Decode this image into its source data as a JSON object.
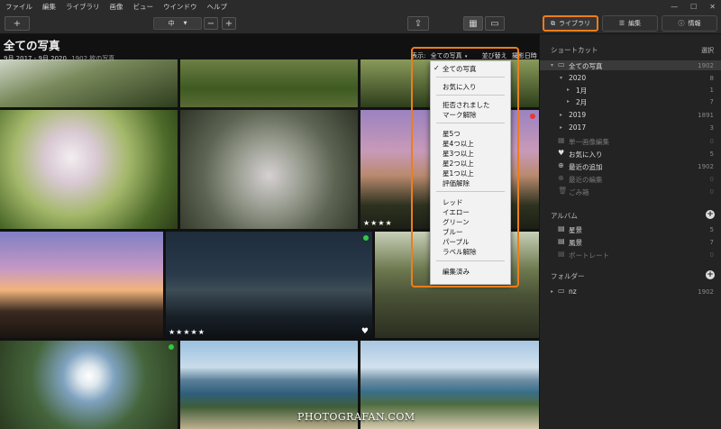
{
  "menubar": {
    "items": [
      "ファイル",
      "編集",
      "ライブラリ",
      "画像",
      "ビュー",
      "ウインドウ",
      "ヘルプ"
    ]
  },
  "window_controls": {
    "minimize": "—",
    "maximize": "☐",
    "close": "✕"
  },
  "toolbar": {
    "add": "+",
    "thumb_size": "中",
    "minus": "−",
    "plus": "+",
    "share": "⇪",
    "grid": "▦",
    "single": "▭",
    "library": "ライブラリ",
    "edit": "編集",
    "info": "情報"
  },
  "gallery": {
    "title": "全ての写真",
    "date_range": "9月 2017 - 9月 2020",
    "count": "1902 枚の写真",
    "view_label": "表示:",
    "view_value": "全ての写真",
    "sort_label": "並び替え",
    "sort_value": "撮影日時"
  },
  "photos": [
    {
      "stars": "",
      "heart": "",
      "dot": ""
    },
    {
      "stars": "",
      "heart": "",
      "dot": ""
    },
    {
      "stars": "",
      "heart": "",
      "dot": ""
    },
    {
      "stars": "",
      "heart": "",
      "dot": ""
    },
    {
      "stars": "",
      "heart": "",
      "dot": ""
    },
    {
      "stars": "★★★★",
      "heart": "",
      "dot": "red"
    },
    {
      "stars": "",
      "heart": "",
      "dot": ""
    },
    {
      "stars": "★★★★★",
      "heart": "♥",
      "dot": "green"
    },
    {
      "stars": "",
      "heart": "",
      "dot": ""
    },
    {
      "stars": "",
      "heart": "",
      "dot": "green"
    },
    {
      "stars": "",
      "heart": "",
      "dot": ""
    },
    {
      "stars": "",
      "heart": "",
      "dot": ""
    }
  ],
  "filter_menu": {
    "checked": "✓",
    "all": "全ての写真",
    "favorites": "お気に入り",
    "rejected": "拒否されました",
    "unmark": "マーク解除",
    "r5": "星5つ",
    "r4": "星4つ以上",
    "r3": "星3つ以上",
    "r2": "星2つ以上",
    "r1": "星1つ以上",
    "unrate": "評価解除",
    "red": "レッド",
    "yellow": "イエロー",
    "green": "グリーン",
    "blue": "ブルー",
    "purple": "パープル",
    "unlabel": "ラベル解除",
    "edited": "編集済み"
  },
  "sidebar": {
    "shortcuts": "ショートカット",
    "select": "選択",
    "all": {
      "label": "全ての写真",
      "count": "1902"
    },
    "y2020": {
      "label": "2020",
      "count": "8"
    },
    "m1": {
      "label": "1月",
      "count": "1"
    },
    "m2": {
      "label": "2月",
      "count": "7"
    },
    "y2019": {
      "label": "2019",
      "count": "1891"
    },
    "y2017": {
      "label": "2017",
      "count": "3"
    },
    "single": {
      "label": "単一画像編集",
      "count": "0"
    },
    "fav": {
      "label": "お気に入り",
      "count": "5"
    },
    "recent_add": {
      "label": "最近の追加",
      "count": "1902"
    },
    "recent_edit": {
      "label": "最近の編集",
      "count": "0"
    },
    "trash": {
      "label": "ごみ箱",
      "count": "0"
    },
    "albums": "アルバム",
    "stars_album": {
      "label": "星景",
      "count": "5"
    },
    "landscape": {
      "label": "風景",
      "count": "7"
    },
    "portrait": {
      "label": "ポートレート",
      "count": "0"
    },
    "folders": "フォルダー",
    "nz": {
      "label": "nz",
      "count": "1902"
    }
  },
  "watermark": "PHOTOGRAFAN.COM",
  "accent_color": "#f07d1a"
}
